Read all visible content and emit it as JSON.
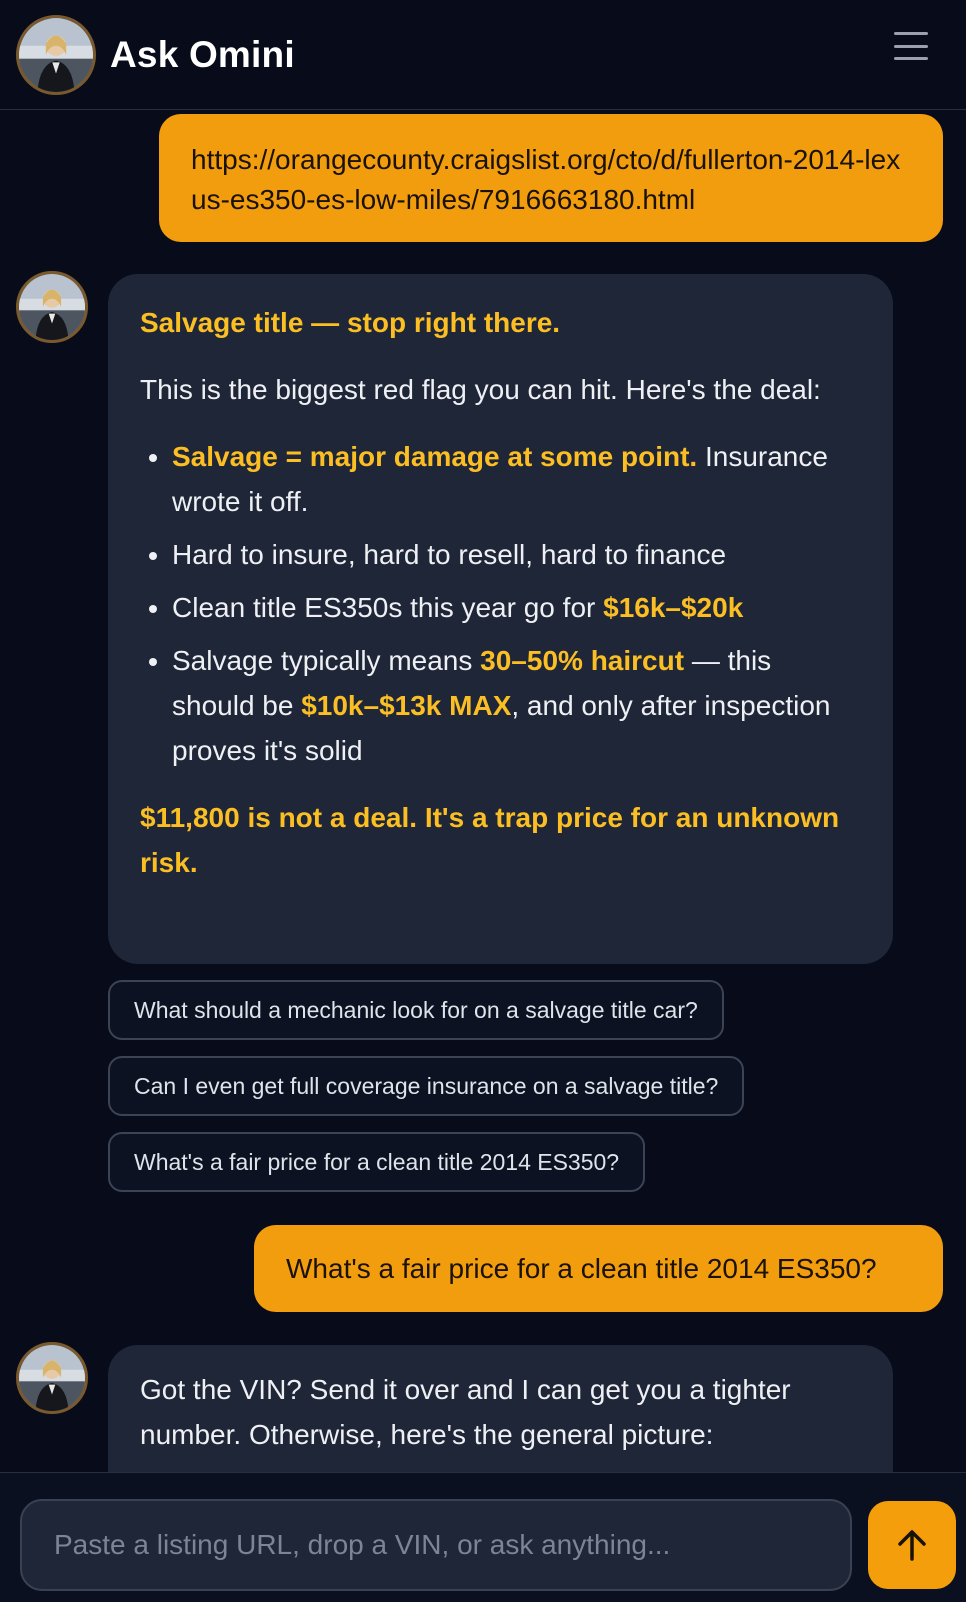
{
  "header": {
    "title": "Ask Omini"
  },
  "messages": {
    "user_1": "https://orangecounty.craigslist.org/cto/d/fullerton-2014-lexus-es350-es-low-miles/7916663180.html",
    "bot_1": {
      "heading": "Salvage title — stop right there.",
      "intro": "This is the biggest red flag you can hit. Here's the deal:",
      "bullets": [
        {
          "strong": "Salvage = major damage at some point.",
          "rest": " Insurance wrote it off."
        },
        {
          "text": "Hard to insure, hard to resell, hard to finance"
        },
        {
          "pre": "Clean title ES350s this year go for ",
          "strong": "$16k–$20k"
        },
        {
          "pre": "Salvage typically means ",
          "strong1": "30–50% haircut",
          "mid": " — this should be ",
          "strong2": "$10k–$13k MAX",
          "post": ", and only after inspection proves it's solid"
        }
      ],
      "closing": "$11,800 is not a deal. It's a trap price for an unknown risk."
    },
    "suggestions": [
      "What should a mechanic look for on a salvage title car?",
      "Can I even get full coverage insurance on a salvage title?",
      "What's a fair price for a clean title 2014 ES350?"
    ],
    "user_2": "What's a fair price for a clean title 2014 ES350?",
    "bot_2": {
      "text": "Got the VIN? Send it over and I can get you a tighter number. Otherwise, here's the general picture:"
    }
  },
  "input": {
    "placeholder": "Paste a listing URL, drop a VIN, or ask anything..."
  },
  "colors": {
    "accent": "#f29d0e",
    "highlight": "#fbbf24",
    "bubble_bg": "#1f2638",
    "page_bg": "#070b1a"
  },
  "icons": {
    "menu": "hamburger-icon",
    "send": "arrow-up-icon"
  }
}
